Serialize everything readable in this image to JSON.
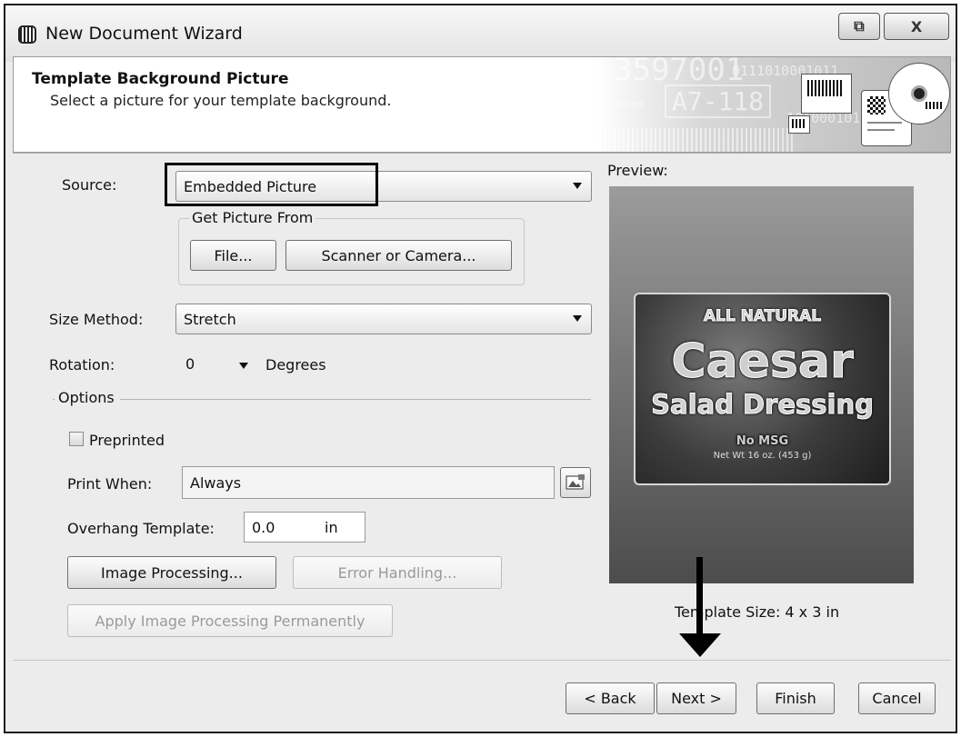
{
  "window": {
    "title": "New Document Wizard",
    "restore_glyph": "⧉",
    "close_glyph": "X"
  },
  "header": {
    "title": "Template Background Picture",
    "subtitle": "Select a picture for your template background.",
    "art_text_1": "3597001",
    "art_text_2": "A7-118",
    "art_binary_1": "0111010001011",
    "art_binary_2": "1010001011",
    "art_small": "X2000"
  },
  "form": {
    "source_label": "Source:",
    "source_value": "Embedded Picture",
    "get_picture_label": "Get Picture From",
    "file_button": "File...",
    "scanner_button": "Scanner or Camera...",
    "size_method_label": "Size Method:",
    "size_method_value": "Stretch",
    "rotation_label": "Rotation:",
    "rotation_value": "0",
    "degrees_label": "Degrees",
    "options_label": "Options",
    "preprinted_label": "Preprinted",
    "preprinted_checked": false,
    "print_when_label": "Print When:",
    "print_when_value": "Always",
    "overhang_label": "Overhang Template:",
    "overhang_value": "0.0",
    "overhang_unit": "in",
    "image_processing_button": "Image Processing...",
    "error_handling_button": "Error Handling...",
    "apply_permanently_button": "Apply Image Processing Permanently"
  },
  "preview": {
    "label": "Preview:",
    "template_size": "Template Size:  4 x 3 in",
    "label_line1": "ALL NATURAL",
    "label_line2": "Caesar",
    "label_line3": "Salad Dressing",
    "label_line4": "No MSG",
    "label_line5": "Net Wt 16 oz. (453 g)"
  },
  "footer": {
    "back_button": "< Back",
    "next_button": "Next >",
    "finish_button": "Finish",
    "cancel_button": "Cancel"
  },
  "colors": {
    "highlight_box": "#000000",
    "arrow": "#000000"
  }
}
